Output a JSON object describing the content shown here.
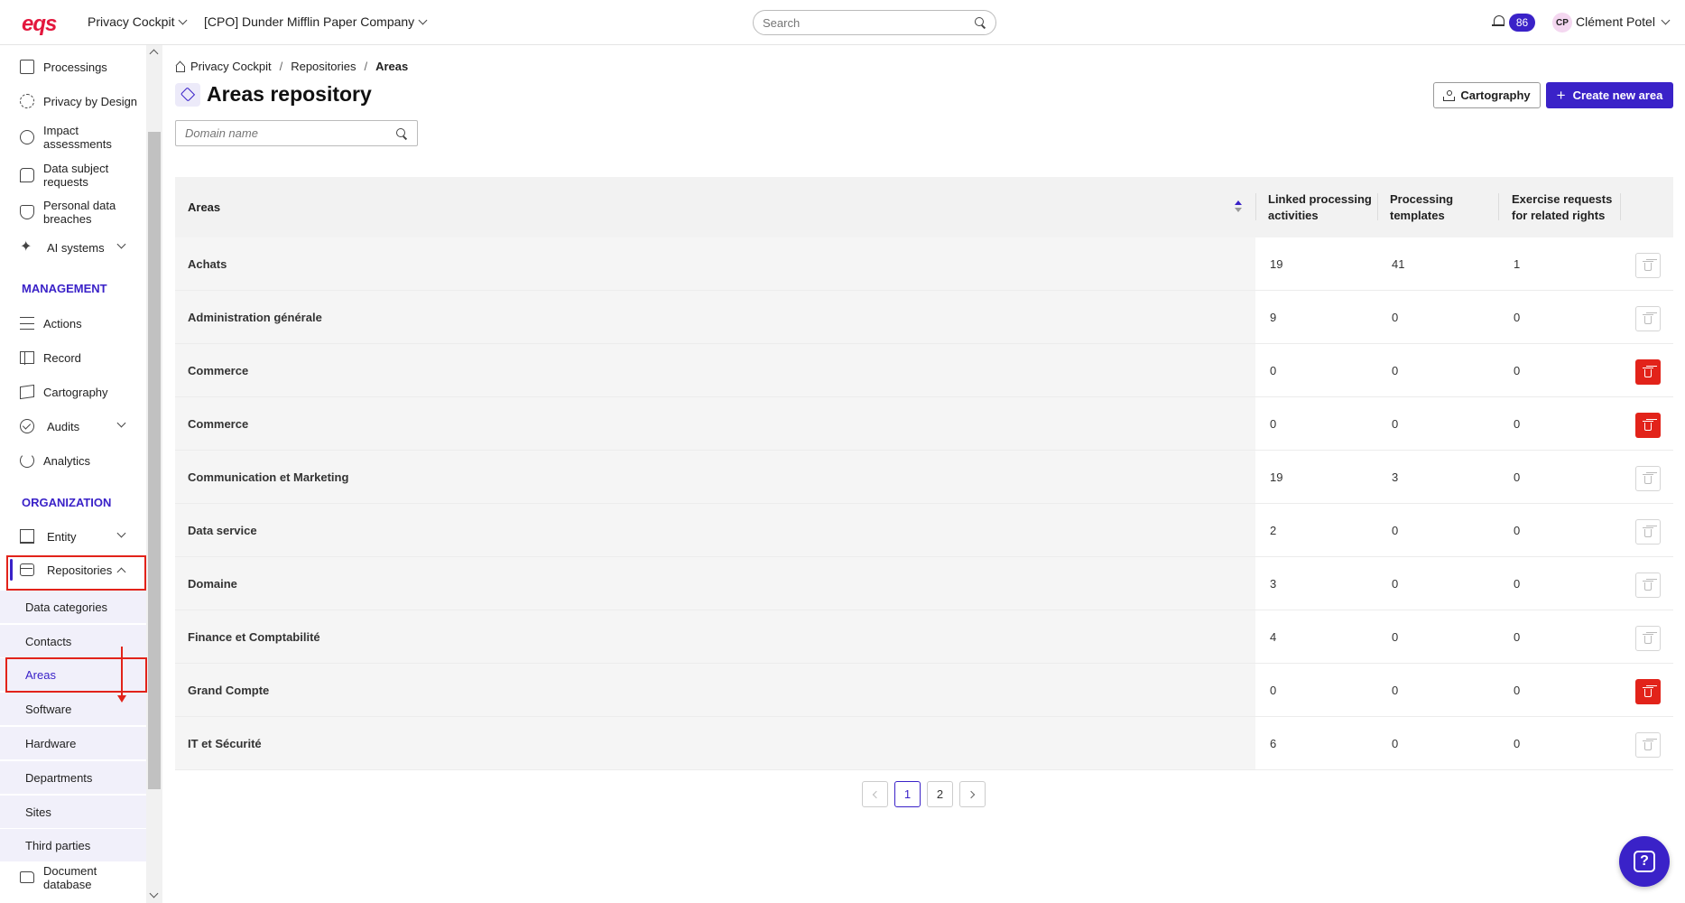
{
  "app": {
    "logo": "eqs",
    "module": "Privacy Cockpit",
    "company": "[CPO] Dunder Mifflin Paper Company",
    "search_placeholder": "Search",
    "notifications_count": "86",
    "user_initials": "CP",
    "user_name": "Clément Potel",
    "brand_color": "#3a22c8",
    "danger_color": "#e2231a"
  },
  "sidebar": {
    "items_top": [
      {
        "label": "Processings",
        "icon": "document-icon"
      },
      {
        "label": "Privacy by Design",
        "icon": "privacy-by-design-icon"
      },
      {
        "label": "Impact assessments",
        "icon": "impact-assessment-icon"
      },
      {
        "label": "Data subject requests",
        "icon": "chat-bubble-icon"
      },
      {
        "label": "Personal data breaches",
        "icon": "shield-icon"
      },
      {
        "label": "AI systems",
        "icon": "sparkle-icon"
      }
    ],
    "management_title": "MANAGEMENT",
    "management_items": [
      {
        "label": "Actions",
        "icon": "list-icon"
      },
      {
        "label": "Record",
        "icon": "table-icon"
      },
      {
        "label": "Cartography",
        "icon": "map-icon"
      },
      {
        "label": "Audits",
        "icon": "check-circle-icon"
      },
      {
        "label": "Analytics",
        "icon": "pie-chart-icon"
      }
    ],
    "organization_title": "ORGANIZATION",
    "organization_items": [
      {
        "label": "Entity",
        "icon": "building-icon"
      },
      {
        "label": "Repositories",
        "icon": "archive-box-icon"
      }
    ],
    "repositories_sub": [
      "Data categories",
      "Contacts",
      "Areas",
      "Software",
      "Hardware",
      "Departments",
      "Sites",
      "Third parties"
    ],
    "bottom_item": {
      "label": "Document database",
      "icon": "folder-icon"
    }
  },
  "breadcrumb": [
    "Privacy Cockpit",
    "Repositories",
    "Areas"
  ],
  "page": {
    "title": "Areas repository",
    "cartography_button": "Cartography",
    "create_button": "Create new area",
    "filter_placeholder": "Domain name"
  },
  "table": {
    "columns": [
      "Areas",
      "Linked processing activities",
      "Processing templates",
      "Exercise requests for related rights"
    ],
    "rows": [
      {
        "area": "Achats",
        "linked": "19",
        "templates": "41",
        "requests": "1",
        "delete_enabled": false
      },
      {
        "area": "Administration générale",
        "linked": "9",
        "templates": "0",
        "requests": "0",
        "delete_enabled": false
      },
      {
        "area": "Commerce",
        "linked": "0",
        "templates": "0",
        "requests": "0",
        "delete_enabled": true
      },
      {
        "area": "Commerce",
        "linked": "0",
        "templates": "0",
        "requests": "0",
        "delete_enabled": true
      },
      {
        "area": "Communication et Marketing",
        "linked": "19",
        "templates": "3",
        "requests": "0",
        "delete_enabled": false
      },
      {
        "area": "Data service",
        "linked": "2",
        "templates": "0",
        "requests": "0",
        "delete_enabled": false
      },
      {
        "area": "Domaine",
        "linked": "3",
        "templates": "0",
        "requests": "0",
        "delete_enabled": false
      },
      {
        "area": "Finance et Comptabilité",
        "linked": "4",
        "templates": "0",
        "requests": "0",
        "delete_enabled": false
      },
      {
        "area": "Grand Compte",
        "linked": "0",
        "templates": "0",
        "requests": "0",
        "delete_enabled": true
      },
      {
        "area": "IT et Sécurité",
        "linked": "6",
        "templates": "0",
        "requests": "0",
        "delete_enabled": false
      }
    ]
  },
  "pagination": {
    "pages": [
      "1",
      "2"
    ],
    "current": "1"
  }
}
